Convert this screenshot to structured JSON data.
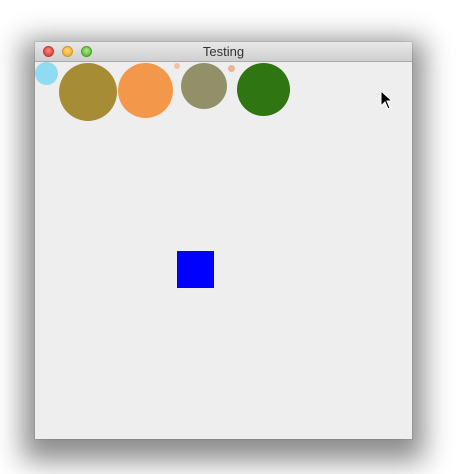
{
  "window": {
    "title": "Testing"
  },
  "canvas": {
    "background": "#eeeeee",
    "shapes": [
      {
        "kind": "circle",
        "name": "circle-light-blue",
        "color": "#8fdcf2"
      },
      {
        "kind": "circle",
        "name": "circle-olive",
        "color": "#a68d35"
      },
      {
        "kind": "circle",
        "name": "circle-orange",
        "color": "#f3984a"
      },
      {
        "kind": "circle",
        "name": "circle-tiny-peach-1",
        "color": "#f0c3a8"
      },
      {
        "kind": "circle",
        "name": "circle-sage",
        "color": "#929068"
      },
      {
        "kind": "circle",
        "name": "circle-tiny-peach-2",
        "color": "#e9b49a"
      },
      {
        "kind": "circle",
        "name": "circle-dark-green",
        "color": "#2f7511"
      },
      {
        "kind": "square",
        "name": "square-blue",
        "color": "#0000ff"
      }
    ]
  },
  "cursor": {
    "icon": "arrow-cursor-icon"
  }
}
